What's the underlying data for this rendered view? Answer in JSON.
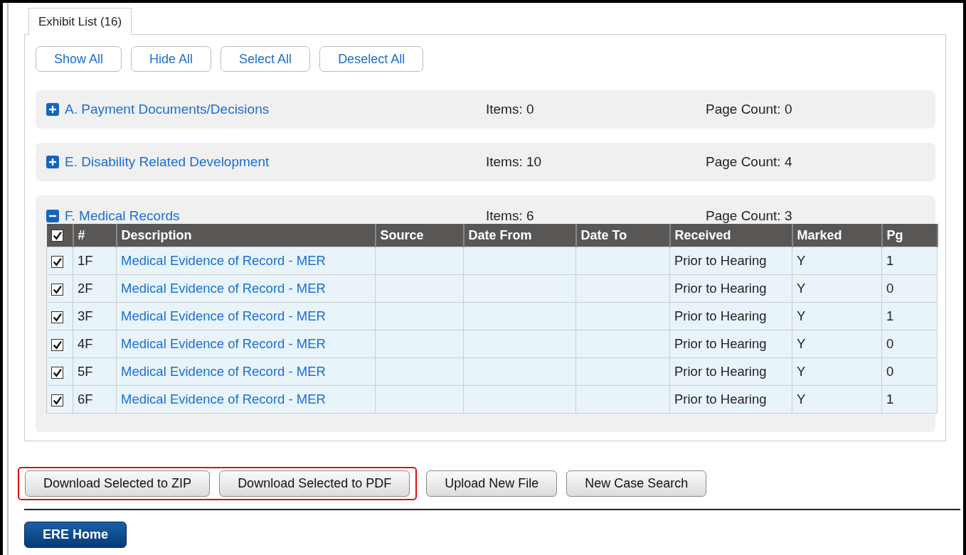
{
  "tabs": [
    {
      "label": "Exhibit List (16)",
      "selected": true
    }
  ],
  "toolbar": [
    "Show All",
    "Hide All",
    "Select All",
    "Deselect All"
  ],
  "sections": [
    {
      "title": "A. Payment Documents/Decisions",
      "expanded": false,
      "items": "Items: 0",
      "page_count": "Page Count: 0"
    },
    {
      "title": "E. Disability Related Development",
      "expanded": false,
      "items": "Items: 10",
      "page_count": "Page Count: 4"
    },
    {
      "title": "F. Medical Records",
      "expanded": true,
      "items": "Items: 6",
      "page_count": "Page Count: 3",
      "table": {
        "all_checked": true,
        "columns": [
          "#",
          "Description",
          "Source",
          "Date From",
          "Date To",
          "Received",
          "Marked",
          "Pg"
        ],
        "rows": [
          {
            "checked": true,
            "number": "1F",
            "description": "Medical Evidence of Record - MER",
            "received": "Prior to Hearing",
            "marked": "Y",
            "pg": "1"
          },
          {
            "checked": true,
            "number": "2F",
            "description": "Medical Evidence of Record - MER",
            "received": "Prior to Hearing",
            "marked": "Y",
            "pg": "0"
          },
          {
            "checked": true,
            "number": "3F",
            "description": "Medical Evidence of Record - MER",
            "received": "Prior to Hearing",
            "marked": "Y",
            "pg": "1"
          },
          {
            "checked": true,
            "number": "4F",
            "description": "Medical Evidence of Record - MER",
            "received": "Prior to Hearing",
            "marked": "Y",
            "pg": "0"
          },
          {
            "checked": true,
            "number": "5F",
            "description": "Medical Evidence of Record - MER",
            "received": "Prior to Hearing",
            "marked": "Y",
            "pg": "0"
          },
          {
            "checked": true,
            "number": "6F",
            "description": "Medical Evidence of Record - MER",
            "received": "Prior to Hearing",
            "marked": "Y",
            "pg": "1"
          }
        ]
      }
    }
  ],
  "actions": [
    {
      "label": "Download Selected to ZIP",
      "highlighted": true
    },
    {
      "label": "Download Selected to PDF",
      "highlighted": true
    },
    {
      "label": "Upload New File",
      "highlighted": false
    },
    {
      "label": "New Case Search",
      "highlighted": false
    }
  ],
  "home_button": "ERE Home"
}
